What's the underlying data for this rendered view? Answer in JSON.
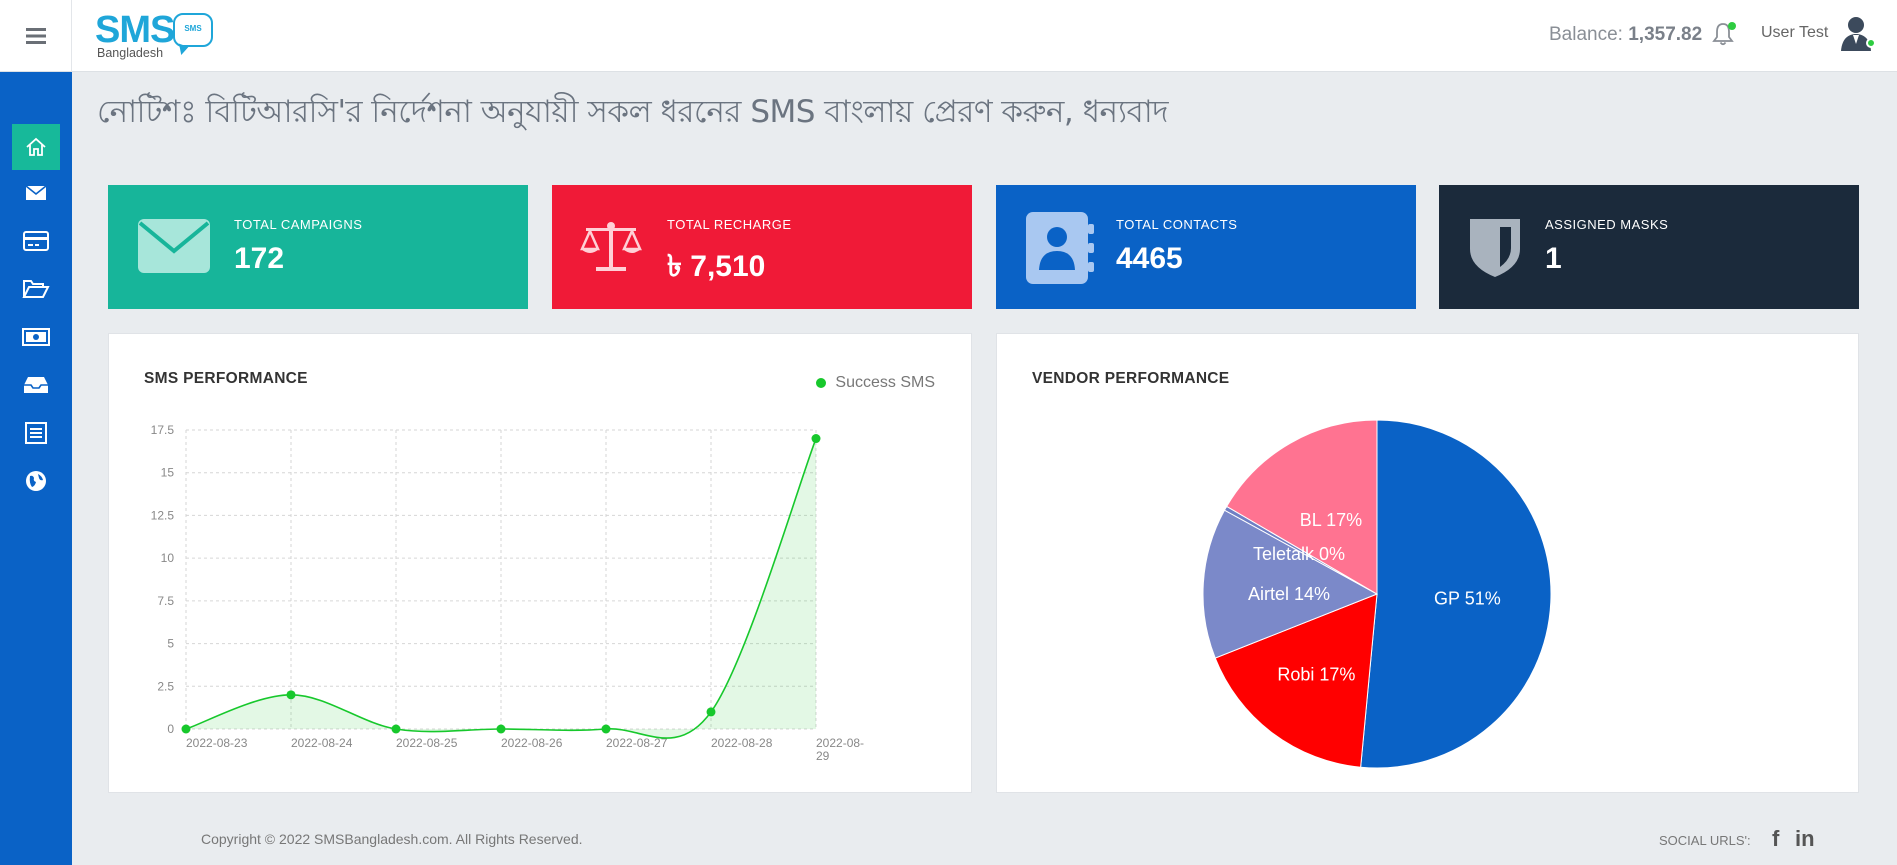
{
  "header": {
    "logo_text": "SMS",
    "logo_subtext": "Bangladesh",
    "logo_bubble": "SMS",
    "balance_label": "Balance:",
    "balance_value": "1,357.82",
    "user_name": "User Test"
  },
  "sidebar": {
    "items": [
      {
        "icon": "home-icon",
        "active": true
      },
      {
        "icon": "envelope-icon",
        "active": false
      },
      {
        "icon": "credit-card-icon",
        "active": false
      },
      {
        "icon": "folder-open-icon",
        "active": false
      },
      {
        "icon": "money-bill-icon",
        "active": false
      },
      {
        "icon": "inbox-icon",
        "active": false
      },
      {
        "icon": "list-icon",
        "active": false
      },
      {
        "icon": "globe-icon",
        "active": false
      }
    ]
  },
  "notice": "নোটিশঃ বিটিআরসি'র নির্দেশনা অনুযায়ী সকল ধরনের SMS বাংলায় প্রেরণ করুন, ধন্যবাদ",
  "stats": [
    {
      "label": "Total Campaigns",
      "value": "172",
      "color": "#17b59a",
      "icon": "envelope-icon"
    },
    {
      "label": "Total Recharge",
      "value": "৳ 7,510",
      "color": "#f01a37",
      "icon": "scale-icon"
    },
    {
      "label": "Total Contacts",
      "value": "4465",
      "color": "#0a62c6",
      "icon": "contact-book-icon"
    },
    {
      "label": "Assigned Masks",
      "value": "1",
      "color": "#1b2a3b",
      "icon": "shield-icon"
    }
  ],
  "sms_performance": {
    "title": "SMS PERFORMANCE",
    "legend": "Success SMS"
  },
  "vendor_performance": {
    "title": "VENDOR PERFORMANCE"
  },
  "chart_data": [
    {
      "type": "area",
      "title": "SMS PERFORMANCE",
      "x": [
        "2022-08-23",
        "2022-08-24",
        "2022-08-25",
        "2022-08-26",
        "2022-08-27",
        "2022-08-28",
        "2022-08-29"
      ],
      "series": [
        {
          "name": "Success SMS",
          "values": [
            0,
            2,
            0,
            0,
            0,
            1,
            17
          ],
          "color": "#17c82c"
        }
      ],
      "yticks": [
        "0",
        "2.5",
        "5",
        "7.5",
        "10",
        "12.5",
        "15",
        "17.5"
      ],
      "ylim": [
        0,
        17.5
      ],
      "grid": true,
      "legend": "top-right"
    },
    {
      "type": "pie",
      "title": "VENDOR PERFORMANCE",
      "slices": [
        {
          "label": "GP",
          "text": "GP 51%",
          "value": 51.5,
          "color": "#0a62c6"
        },
        {
          "label": "Robi",
          "text": "Robi 17%",
          "value": 17.5,
          "color": "#ff0000"
        },
        {
          "label": "Airtel",
          "text": "Airtel 14%",
          "value": 14,
          "color": "#7b89c9"
        },
        {
          "label": "Teletalk",
          "text": "Teletalk 0%",
          "value": 0.4,
          "color": "#6f7fc4"
        },
        {
          "label": "BL",
          "text": "BL 17%",
          "value": 16.6,
          "color": "#ff7391"
        }
      ]
    }
  ],
  "footer": {
    "copyright": "Copyright © 2022 SMSBangladesh.com. All Rights Reserved.",
    "social_label": "SOCIAL URLS':",
    "facebook_glyph": "f",
    "linkedin_glyph": "in"
  }
}
